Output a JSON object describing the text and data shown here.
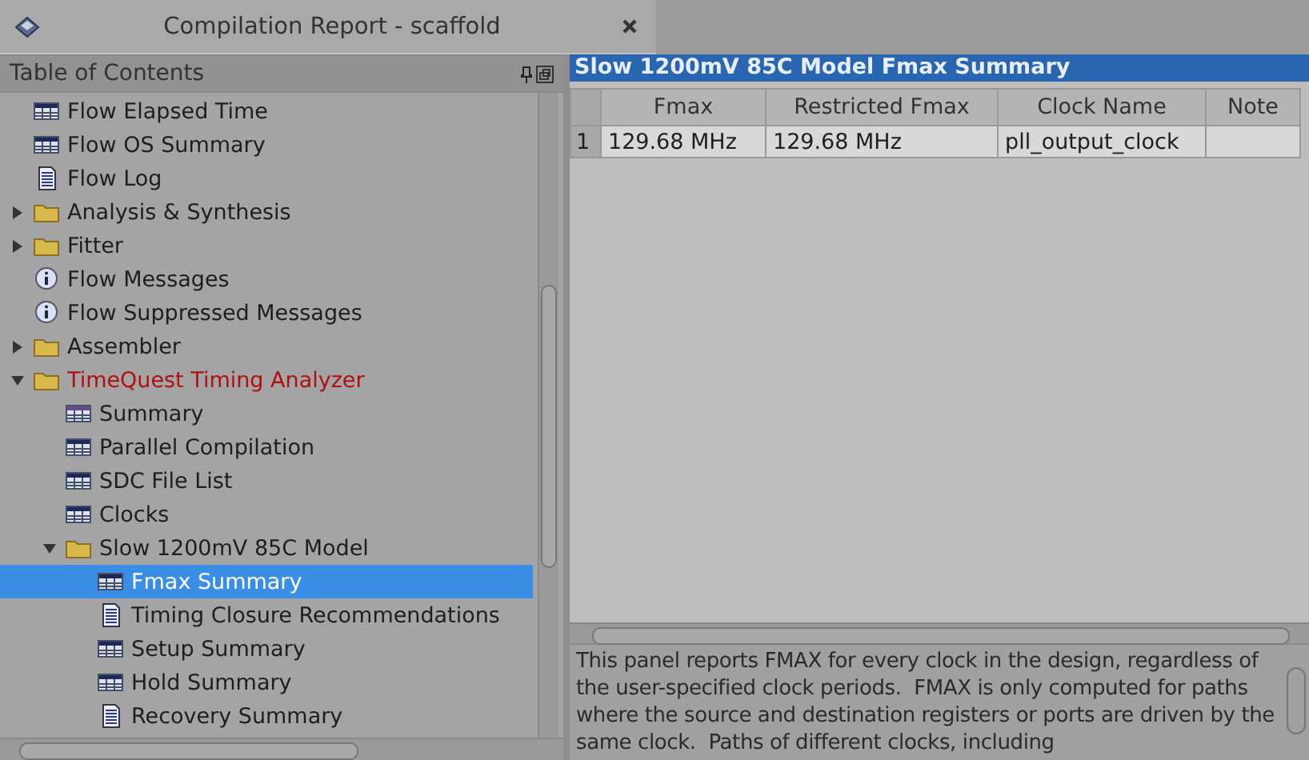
{
  "window": {
    "title": "Compilation Report - scaffold"
  },
  "sidebar": {
    "title": "Table of Contents",
    "items": [
      {
        "label": "Flow Elapsed Time",
        "kind": "table",
        "selected": false
      },
      {
        "label": "Flow OS Summary",
        "kind": "table",
        "selected": false
      },
      {
        "label": "Flow Log",
        "kind": "log",
        "selected": false
      },
      {
        "label": "Analysis & Synthesis",
        "kind": "folder",
        "expanded": false,
        "selected": false
      },
      {
        "label": "Fitter",
        "kind": "folder",
        "expanded": false,
        "selected": false
      },
      {
        "label": "Flow Messages",
        "kind": "info",
        "selected": false
      },
      {
        "label": "Flow Suppressed Messages",
        "kind": "info",
        "selected": false
      },
      {
        "label": "Assembler",
        "kind": "folder",
        "expanded": false,
        "selected": false
      },
      {
        "label": "TimeQuest Timing Analyzer",
        "kind": "folder",
        "expanded": true,
        "selected": false,
        "color": "#b01010",
        "children": [
          {
            "label": "Summary",
            "kind": "summary",
            "selected": false
          },
          {
            "label": "Parallel Compilation",
            "kind": "table",
            "selected": false
          },
          {
            "label": "SDC File List",
            "kind": "table",
            "selected": false
          },
          {
            "label": "Clocks",
            "kind": "table",
            "selected": false
          },
          {
            "label": "Slow 1200mV 85C Model",
            "kind": "folder",
            "expanded": true,
            "selected": false,
            "children": [
              {
                "label": "Fmax Summary",
                "kind": "table",
                "selected": true
              },
              {
                "label": "Timing Closure Recommendations",
                "kind": "log",
                "selected": false
              },
              {
                "label": "Setup Summary",
                "kind": "table",
                "selected": false
              },
              {
                "label": "Hold Summary",
                "kind": "table",
                "selected": false
              },
              {
                "label": "Recovery Summary",
                "kind": "log",
                "selected": false
              }
            ]
          }
        ]
      }
    ]
  },
  "report": {
    "title": "Slow 1200mV 85C Model Fmax Summary",
    "table": {
      "columns": [
        "Fmax",
        "Restricted Fmax",
        "Clock Name",
        "Note"
      ],
      "rows": [
        {
          "index": "1",
          "cells": [
            "129.68 MHz",
            "129.68 MHz",
            "pll_output_clock",
            ""
          ]
        }
      ]
    },
    "description": "This panel reports FMAX for every clock in the design, regardless of the user-specified clock periods.  FMAX is only computed for paths where the source and destination registers or ports are driven by the same clock.  Paths of different clocks, including"
  }
}
